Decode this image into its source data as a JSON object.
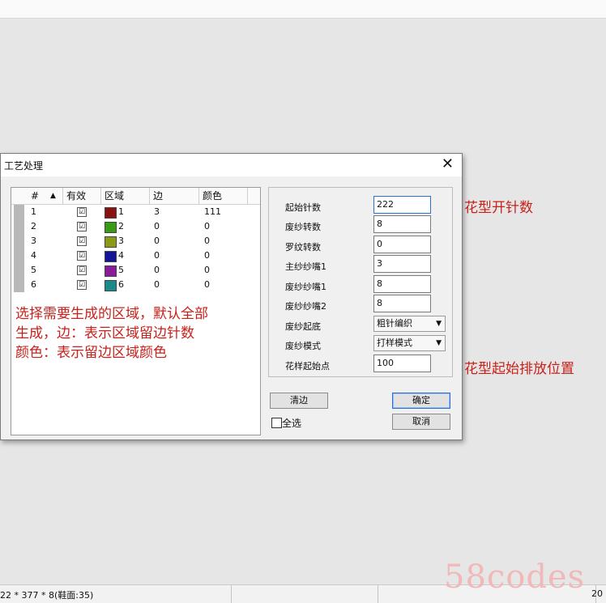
{
  "dialog": {
    "title": "工艺处理",
    "close_glyph": "✕"
  },
  "table": {
    "headers": [
      "#",
      "有效",
      "区域",
      "边",
      "颜色"
    ],
    "rows": [
      {
        "num": "1",
        "check": "☑",
        "area": "1",
        "color": "#8b1010",
        "edge": "3",
        "colorval": "111"
      },
      {
        "num": "2",
        "check": "☑",
        "area": "2",
        "color": "#3a9a14",
        "edge": "0",
        "colorval": "0"
      },
      {
        "num": "3",
        "check": "☑",
        "area": "3",
        "color": "#8a9a16",
        "edge": "0",
        "colorval": "0"
      },
      {
        "num": "4",
        "check": "☑",
        "area": "4",
        "color": "#14149a",
        "edge": "0",
        "colorval": "0"
      },
      {
        "num": "5",
        "check": "☑",
        "area": "5",
        "color": "#8a1c9c",
        "edge": "0",
        "colorval": "0"
      },
      {
        "num": "6",
        "check": "☑",
        "area": "6",
        "color": "#1a8a8a",
        "edge": "0",
        "colorval": "0"
      }
    ]
  },
  "note_lines": [
    "选择需要生成的区域，默认全部",
    "生成，边：表示区域留边针数",
    "颜色：表示留边区域颜色"
  ],
  "fields": {
    "start_needles": {
      "label": "起始针数",
      "value": "222"
    },
    "waste_turns": {
      "label": "废纱转数",
      "value": "8"
    },
    "rib_turns": {
      "label": "罗纹转数",
      "value": "0"
    },
    "main_feeder": {
      "label": "主纱纱嘴1",
      "value": "3"
    },
    "waste_feeder1": {
      "label": "废纱纱嘴1",
      "value": "8"
    },
    "waste_feeder2": {
      "label": "废纱纱嘴2",
      "value": "8"
    },
    "waste_start": {
      "label": "废纱起底",
      "value": "粗针编织"
    },
    "waste_mode": {
      "label": "废纱模式",
      "value": "打样模式"
    },
    "pattern_start": {
      "label": "花样起始点",
      "value": "100"
    }
  },
  "buttons": {
    "clear_edge": "清边",
    "ok": "确定",
    "cancel": "取消",
    "select_all": "全选"
  },
  "annotations": {
    "start_needles": "花型开针数",
    "pattern_start": "花型起始排放位置"
  },
  "statusbar": {
    "left": "22 * 377 * 8(鞋面:35)",
    "right": "20"
  },
  "watermark": "58codes",
  "colors": {
    "annotation": "#c8201a",
    "focus": "#2a6fd6"
  }
}
